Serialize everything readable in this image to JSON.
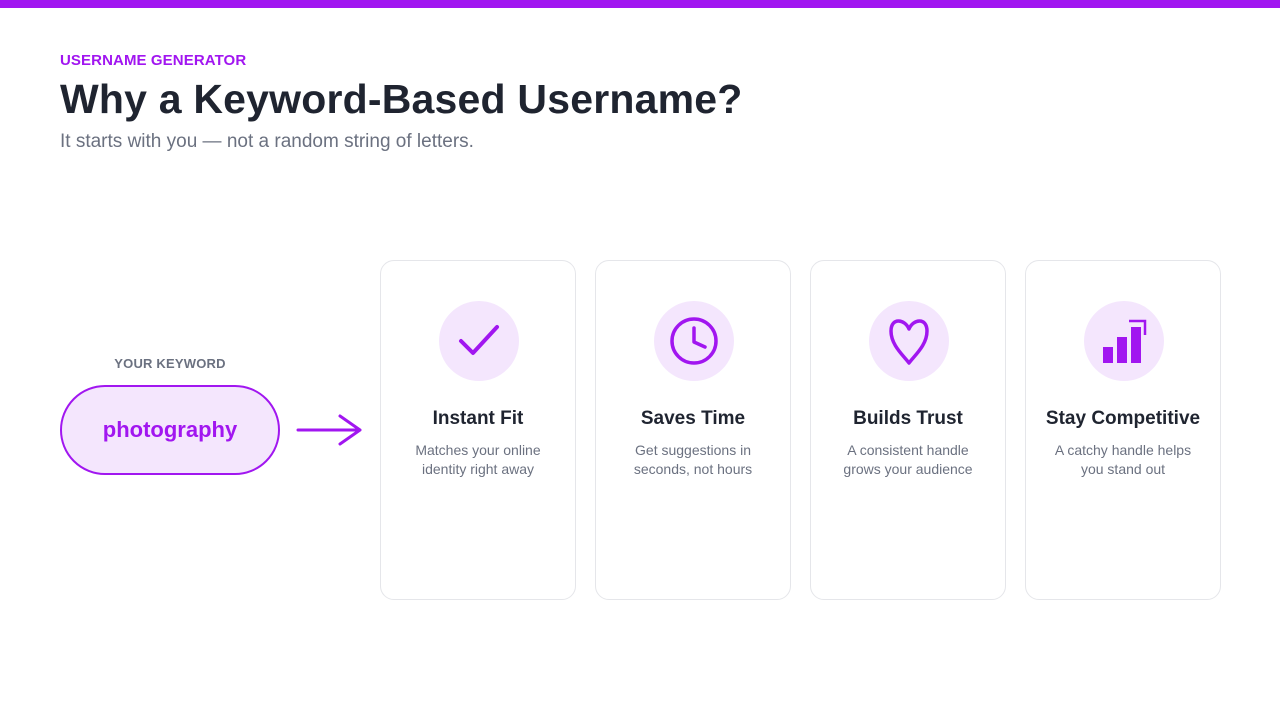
{
  "colors": {
    "accent": "#a116f0",
    "accent_light": "#f4e6fd",
    "heading": "#1f2430",
    "muted": "#6b7180",
    "card_border": "#e5e6ea"
  },
  "header": {
    "eyebrow": "USERNAME GENERATOR",
    "title": "Why a Keyword-Based Username?",
    "subtitle": "It starts with you — not a random string of letters."
  },
  "keyword": {
    "label": "YOUR KEYWORD",
    "value": "photography"
  },
  "cards": [
    {
      "icon": "checkmark-icon",
      "title": "Instant Fit",
      "desc": "Matches your online identity right away"
    },
    {
      "icon": "clock-icon",
      "title": "Saves Time",
      "desc": "Get suggestions in seconds, not hours"
    },
    {
      "icon": "heart-icon",
      "title": "Builds Trust",
      "desc": "A consistent handle grows your audience"
    },
    {
      "icon": "bar-chart-icon",
      "title": "Stay Competitive",
      "desc": "A catchy handle helps you stand out"
    }
  ]
}
